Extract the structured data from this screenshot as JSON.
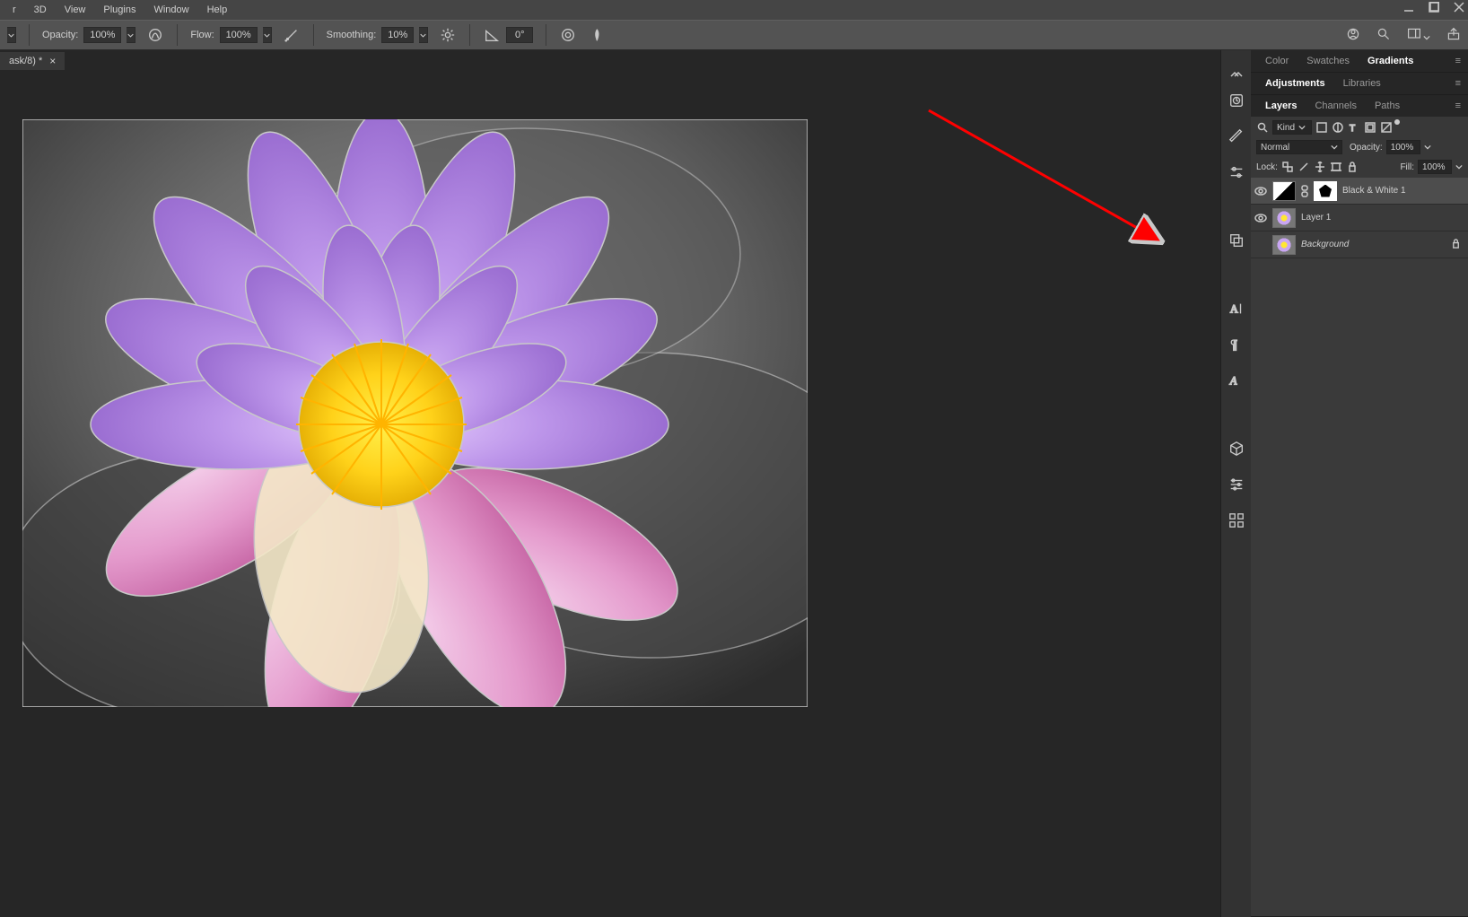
{
  "menu": {
    "items": [
      "r",
      "3D",
      "View",
      "Plugins",
      "Window",
      "Help"
    ]
  },
  "options": {
    "opacity_label": "Opacity:",
    "opacity_value": "100%",
    "flow_label": "Flow:",
    "flow_value": "100%",
    "smoothing_label": "Smoothing:",
    "smoothing_value": "10%",
    "angle_value": "0°"
  },
  "doc_tab": {
    "title": "ask/8) *"
  },
  "panel1": {
    "tabs": [
      "Color",
      "Swatches",
      "Gradients"
    ],
    "active": 2
  },
  "panel2": {
    "tabs": [
      "Adjustments",
      "Libraries"
    ],
    "active": 0
  },
  "panel3": {
    "tabs": [
      "Layers",
      "Channels",
      "Paths"
    ],
    "active": 0
  },
  "layers_panel": {
    "filter_label": "Kind",
    "blend_mode": "Normal",
    "opacity_label": "Opacity:",
    "opacity_value": "100%",
    "lock_label": "Lock:",
    "fill_label": "Fill:",
    "fill_value": "100%",
    "layers": [
      {
        "name": "Black & White 1",
        "visible": true,
        "selected": true,
        "type": "adjustment"
      },
      {
        "name": "Layer 1",
        "visible": true,
        "selected": false,
        "type": "image"
      },
      {
        "name": "Background",
        "visible": false,
        "selected": false,
        "type": "image",
        "locked": true,
        "italic": true
      }
    ]
  }
}
